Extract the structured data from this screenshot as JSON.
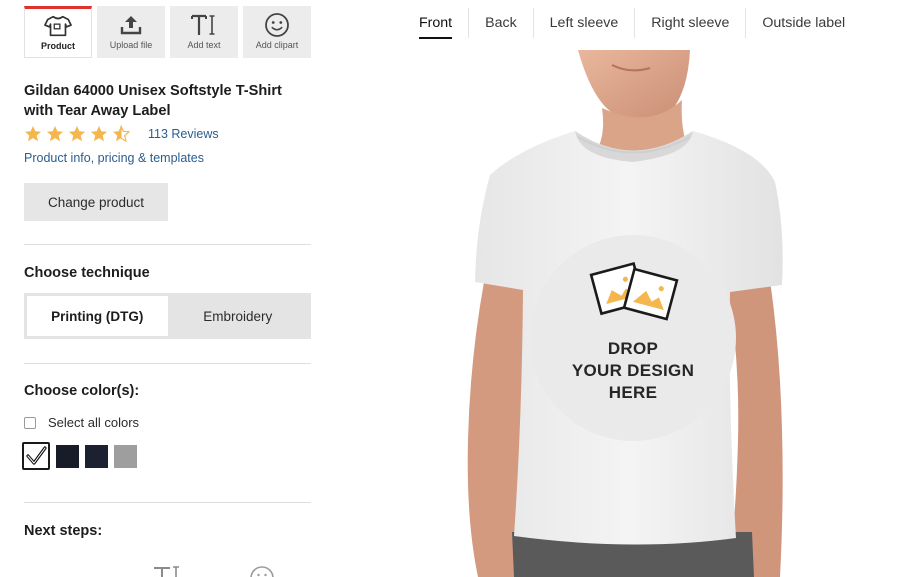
{
  "toolbar": {
    "items": [
      {
        "label": "Product",
        "icon": "tshirt-icon"
      },
      {
        "label": "Upload file",
        "icon": "upload-icon"
      },
      {
        "label": "Add text",
        "icon": "text-icon"
      },
      {
        "label": "Add clipart",
        "icon": "smiley-icon"
      }
    ]
  },
  "product": {
    "title": "Gildan 64000 Unisex Softstyle T-Shirt with Tear Away Label",
    "rating": 4.5,
    "reviews": "113 Reviews",
    "info_link": "Product info, pricing & templates",
    "change_button": "Change product"
  },
  "technique": {
    "heading": "Choose technique",
    "options": [
      "Printing (DTG)",
      "Embroidery"
    ],
    "selected": "Printing (DTG)"
  },
  "colors": {
    "heading": "Choose color(s):",
    "select_all": "Select all colors",
    "swatches": [
      "#ffffff",
      "#181c28",
      "#1b2130",
      "#9e9e9e"
    ],
    "selected_index": 0
  },
  "next_steps": {
    "heading": "Next steps:"
  },
  "view_tabs": {
    "items": [
      "Front",
      "Back",
      "Left sleeve",
      "Right sleeve",
      "Outside label"
    ],
    "active": "Front"
  },
  "design_area": {
    "line1": "DROP",
    "line2": "YOUR DESIGN",
    "line3": "HERE"
  },
  "colors_theme": {
    "accent": "#e2302f",
    "link": "#2a5d8f",
    "star": "#f3b74e"
  }
}
